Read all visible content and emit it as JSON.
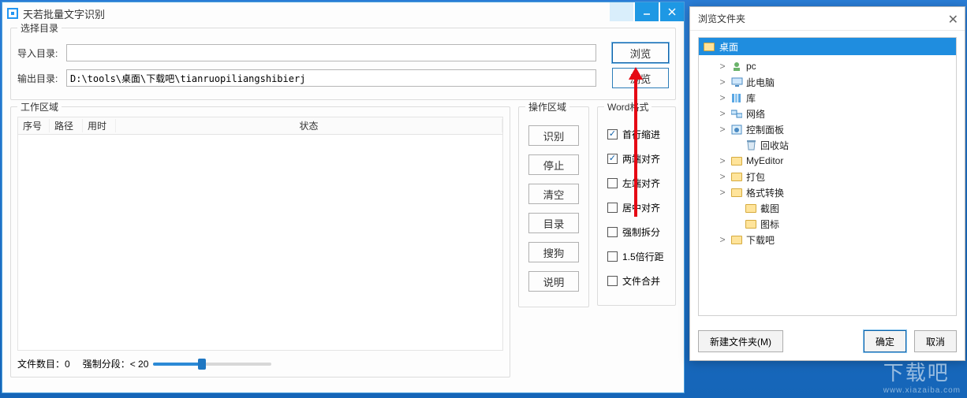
{
  "main": {
    "title": "天若批量文字识别",
    "dir_group": {
      "legend": "选择目录",
      "import_label": "导入目录:",
      "import_value": "",
      "output_label": "输出目录:",
      "output_value": "D:\\tools\\桌面\\下载吧\\tianruopiliangshibierj",
      "browse_label": "浏览"
    },
    "work_group": {
      "legend": "工作区域",
      "cols": {
        "idx": "序号",
        "path": "路径",
        "time": "用时",
        "status": "状态"
      }
    },
    "op_group": {
      "legend": "操作区域",
      "buttons": [
        "识别",
        "停止",
        "清空",
        "目录",
        "搜狗",
        "说明"
      ]
    },
    "word_group": {
      "legend": "Word格式",
      "options": [
        {
          "label": "首行缩进",
          "checked": true
        },
        {
          "label": "两端对齐",
          "checked": true
        },
        {
          "label": "左端对齐",
          "checked": false
        },
        {
          "label": "居中对齐",
          "checked": false
        },
        {
          "label": "强制拆分",
          "checked": false
        },
        {
          "label": "1.5倍行距",
          "checked": false
        },
        {
          "label": "文件合并",
          "checked": false
        }
      ]
    },
    "footer": {
      "file_count_label": "文件数目：0",
      "force_seg_label": "强制分段：< 20"
    }
  },
  "browse": {
    "title": "浏览文件夹",
    "root": "桌面",
    "nodes": [
      {
        "depth": 1,
        "twisty": ">",
        "icon": "pc",
        "label": "pc"
      },
      {
        "depth": 1,
        "twisty": ">",
        "icon": "thispc",
        "label": "此电脑"
      },
      {
        "depth": 1,
        "twisty": ">",
        "icon": "lib",
        "label": "库"
      },
      {
        "depth": 1,
        "twisty": ">",
        "icon": "net",
        "label": "网络"
      },
      {
        "depth": 1,
        "twisty": ">",
        "icon": "panel",
        "label": "控制面板"
      },
      {
        "depth": 2,
        "twisty": "",
        "icon": "bin",
        "label": "回收站"
      },
      {
        "depth": 1,
        "twisty": ">",
        "icon": "folder",
        "label": "MyEditor"
      },
      {
        "depth": 1,
        "twisty": ">",
        "icon": "folder",
        "label": "打包"
      },
      {
        "depth": 1,
        "twisty": ">",
        "icon": "folder",
        "label": "格式转换"
      },
      {
        "depth": 2,
        "twisty": "",
        "icon": "folder",
        "label": "截图"
      },
      {
        "depth": 2,
        "twisty": "",
        "icon": "folder",
        "label": "图标"
      },
      {
        "depth": 1,
        "twisty": ">",
        "icon": "folder",
        "label": "下载吧"
      }
    ],
    "buttons": {
      "new_folder": "新建文件夹(M)",
      "ok": "确定",
      "cancel": "取消"
    }
  },
  "watermark": {
    "text": "下载吧",
    "sub": "www.xiazaiba.com"
  }
}
